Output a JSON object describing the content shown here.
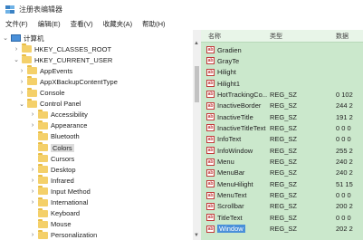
{
  "window": {
    "title": "注册表编辑器"
  },
  "menu": [
    "文件(F)",
    "编辑(E)",
    "查看(V)",
    "收藏夹(A)",
    "帮助(H)"
  ],
  "tree": [
    {
      "label": "计算机",
      "indent": 0,
      "chev": "v",
      "icon": "pc"
    },
    {
      "label": "HKEY_CLASSES_ROOT",
      "indent": 1,
      "chev": ">",
      "icon": "folder"
    },
    {
      "label": "HKEY_CURRENT_USER",
      "indent": 1,
      "chev": "v",
      "icon": "folder"
    },
    {
      "label": "AppEvents",
      "indent": 2,
      "chev": ">",
      "icon": "folder"
    },
    {
      "label": "AppXBackupContentType",
      "indent": 2,
      "chev": ">",
      "icon": "folder"
    },
    {
      "label": "Console",
      "indent": 2,
      "chev": ">",
      "icon": "folder"
    },
    {
      "label": "Control Panel",
      "indent": 2,
      "chev": "v",
      "icon": "folder"
    },
    {
      "label": "Accessibility",
      "indent": 3,
      "chev": ">",
      "icon": "folder"
    },
    {
      "label": "Appearance",
      "indent": 3,
      "chev": ">",
      "icon": "folder"
    },
    {
      "label": "Bluetooth",
      "indent": 3,
      "chev": "",
      "icon": "folder"
    },
    {
      "label": "Colors",
      "indent": 3,
      "chev": "",
      "icon": "folder",
      "selected": true
    },
    {
      "label": "Cursors",
      "indent": 3,
      "chev": "",
      "icon": "folder"
    },
    {
      "label": "Desktop",
      "indent": 3,
      "chev": ">",
      "icon": "folder"
    },
    {
      "label": "Infrared",
      "indent": 3,
      "chev": ">",
      "icon": "folder"
    },
    {
      "label": "Input Method",
      "indent": 3,
      "chev": ">",
      "icon": "folder"
    },
    {
      "label": "International",
      "indent": 3,
      "chev": ">",
      "icon": "folder"
    },
    {
      "label": "Keyboard",
      "indent": 3,
      "chev": "",
      "icon": "folder"
    },
    {
      "label": "Mouse",
      "indent": 3,
      "chev": "",
      "icon": "folder"
    },
    {
      "label": "Personalization",
      "indent": 3,
      "chev": ">",
      "icon": "folder"
    }
  ],
  "list": {
    "headers": {
      "name": "名称",
      "type": "类型",
      "data": "数据"
    },
    "rows": [
      {
        "name": "Gradien",
        "type": "",
        "data": ""
      },
      {
        "name": "GrayTe",
        "type": "",
        "data": ""
      },
      {
        "name": "Hilight",
        "type": "",
        "data": ""
      },
      {
        "name": "Hilight1",
        "type": "",
        "data": ""
      },
      {
        "name": "HotTrackingCo...",
        "type": "REG_SZ",
        "data": "0 102"
      },
      {
        "name": "InactiveBorder",
        "type": "REG_SZ",
        "data": "244 2"
      },
      {
        "name": "InactiveTitle",
        "type": "REG_SZ",
        "data": "191 2"
      },
      {
        "name": "InactiveTitleText",
        "type": "REG_SZ",
        "data": "0 0 0"
      },
      {
        "name": "InfoText",
        "type": "REG_SZ",
        "data": "0 0 0"
      },
      {
        "name": "InfoWindow",
        "type": "REG_SZ",
        "data": "255 2"
      },
      {
        "name": "Menu",
        "type": "REG_SZ",
        "data": "240 2"
      },
      {
        "name": "MenuBar",
        "type": "REG_SZ",
        "data": "240 2"
      },
      {
        "name": "MenuHilight",
        "type": "REG_SZ",
        "data": "51 15"
      },
      {
        "name": "MenuText",
        "type": "REG_SZ",
        "data": "0 0 0"
      },
      {
        "name": "Scrollbar",
        "type": "REG_SZ",
        "data": "200 2"
      },
      {
        "name": "TitleText",
        "type": "REG_SZ",
        "data": "0 0 0"
      },
      {
        "name": "Window",
        "type": "REG_SZ",
        "data": "202 2",
        "selected": true
      }
    ]
  },
  "colors": {
    "list_bg": "#cbe8cc",
    "folder": "#f4d06a",
    "selection": "#4a90d9"
  }
}
